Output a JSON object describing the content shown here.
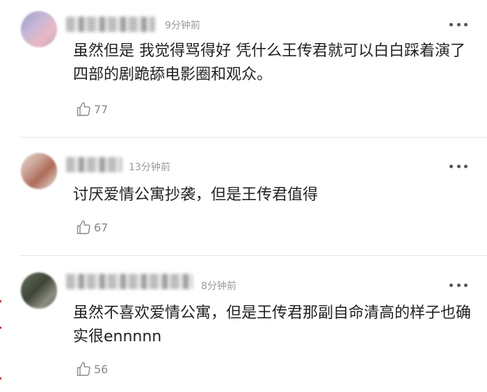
{
  "comments": [
    {
      "time": "9分钟前",
      "text": "虽然但是 我觉得骂得好 凭什么王传君就可以白白踩着演了四部的剧跪舔电影圈和观众。",
      "likes": "77"
    },
    {
      "time": "13分钟前",
      "text": "讨厌爱情公寓抄袭，但是王传君值得",
      "likes": "67"
    },
    {
      "time": "8分钟前",
      "text": "虽然不喜欢爱情公寓，但是王传君那副自命清高的样子也确实很ennnnn",
      "likes": "56"
    }
  ],
  "icons": {
    "more": "more-dots-icon",
    "like": "thumbs-up-icon"
  },
  "colors": {
    "time": "#999999",
    "text": "#222222",
    "like": "#888888",
    "divider": "#e6e6e6"
  }
}
